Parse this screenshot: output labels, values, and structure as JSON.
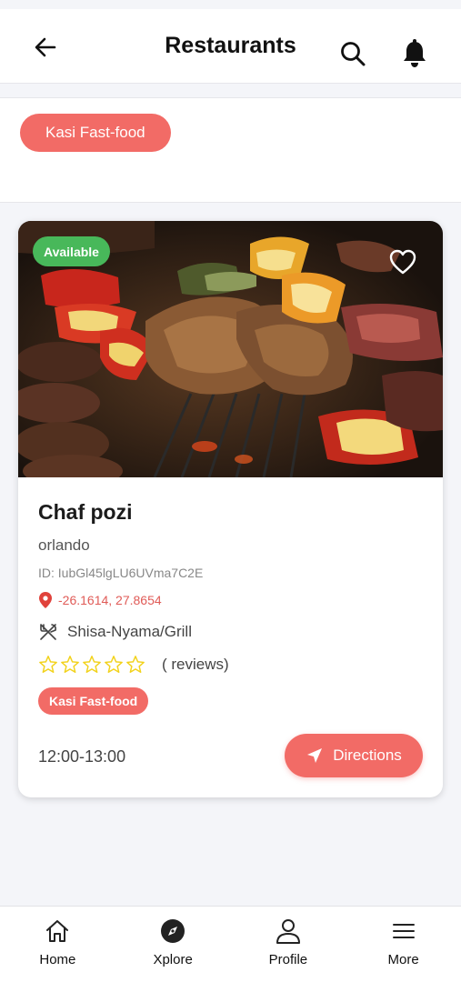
{
  "header": {
    "title": "Restaurants",
    "icons": {
      "back": "arrow-left-icon",
      "search": "search-icon",
      "notifications": "bell-icon"
    }
  },
  "filters": {
    "chips": [
      {
        "label": "Kasi Fast-food",
        "selected": true
      }
    ]
  },
  "restaurant": {
    "status_badge": "Available",
    "name": "Chaf pozi",
    "location": "orlando",
    "id_text": "ID: IubGl45lgLU6UVma7C2E",
    "coordinates": "-26.1614, 27.8654",
    "cuisine": "Shisa-Nyama/Grill",
    "rating_value": 0,
    "rating_max": 5,
    "reviews_text": "( reviews)",
    "category_tag": "Kasi Fast-food",
    "hours": "12:00-13:00",
    "directions_label": "Directions",
    "favorite": false
  },
  "colors": {
    "accent": "#f26b66",
    "available": "#48b85a",
    "star": "#f2d21b",
    "coordinate_text": "#e05b57"
  },
  "bottom_nav": {
    "items": [
      {
        "label": "Home",
        "icon": "home-icon"
      },
      {
        "label": "Xplore",
        "icon": "compass-icon"
      },
      {
        "label": "Profile",
        "icon": "user-icon"
      },
      {
        "label": "More",
        "icon": "menu-icon"
      }
    ]
  }
}
